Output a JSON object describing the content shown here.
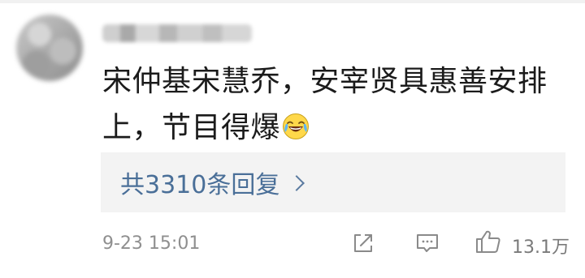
{
  "comment": {
    "text": "宋仲基宋慧乔，安宰贤具惠善安排上，节目得爆",
    "emoji": "laughing-crying-emoji"
  },
  "replies": {
    "label": "共3310条回复"
  },
  "footer": {
    "time": "9-23 15:01",
    "likes": "13.1万"
  },
  "icons": {
    "share": "share-icon",
    "reply": "comment-icon",
    "like": "thumbs-up-icon"
  },
  "colors": {
    "reply_link": "#4a6f98",
    "reply_bg": "#f3f3f3"
  }
}
